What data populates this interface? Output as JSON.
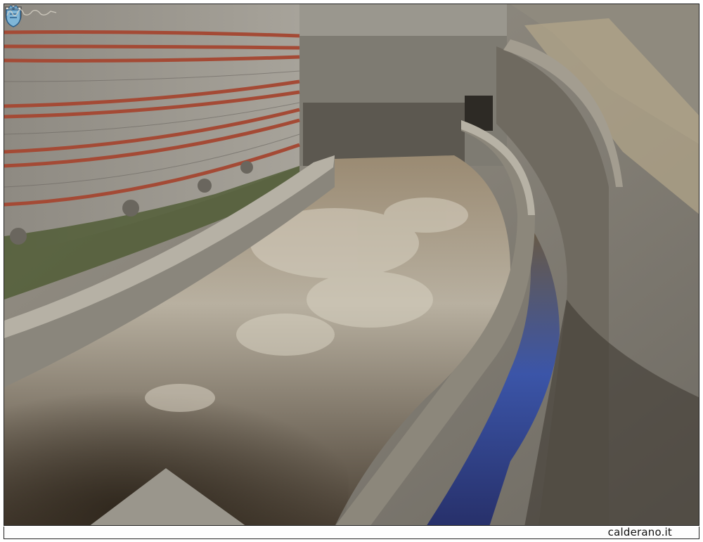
{
  "footer": {
    "site_label": "calderano.it"
  },
  "icons": {
    "top_left_logo": "crest-logo",
    "bottom_right_logo": "crest-logo",
    "signature": "handwritten-signature"
  },
  "colors": {
    "frame_border": "#222222",
    "caption_background": "#fdfdfd",
    "water": "#3b55a8",
    "brick": "#a44a35",
    "stone": "#8f8c84"
  }
}
